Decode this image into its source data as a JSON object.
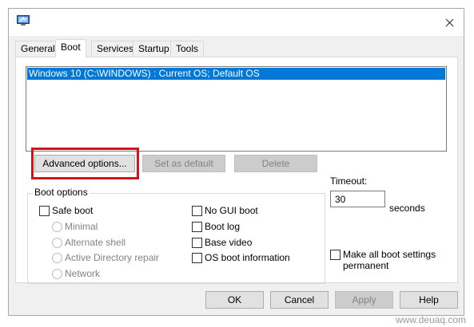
{
  "tabs": [
    {
      "label": "General"
    },
    {
      "label": "Boot"
    },
    {
      "label": "Services"
    },
    {
      "label": "Startup"
    },
    {
      "label": "Tools"
    }
  ],
  "boot_list": {
    "items": [
      {
        "label": "Windows 10 (C:\\WINDOWS) : Current OS; Default OS",
        "selected": true
      }
    ]
  },
  "buttons": {
    "advanced": "Advanced options...",
    "set_default": "Set as default",
    "delete": "Delete",
    "ok": "OK",
    "cancel": "Cancel",
    "apply": "Apply",
    "help": "Help"
  },
  "boot_options": {
    "title": "Boot options",
    "safe_boot": "Safe boot",
    "radios": [
      "Minimal",
      "Alternate shell",
      "Active Directory repair",
      "Network"
    ],
    "checkboxes": [
      "No GUI boot",
      "Boot log",
      "Base video",
      "OS boot information"
    ]
  },
  "timeout": {
    "label": "Timeout:",
    "value": "30",
    "unit": "seconds"
  },
  "make_permanent": {
    "line1": "Make all boot settings",
    "line2": "permanent"
  },
  "watermark": "www.deuaq.com",
  "colors": {
    "selection": "#0078d7",
    "highlight_outline": "#d2151a"
  }
}
